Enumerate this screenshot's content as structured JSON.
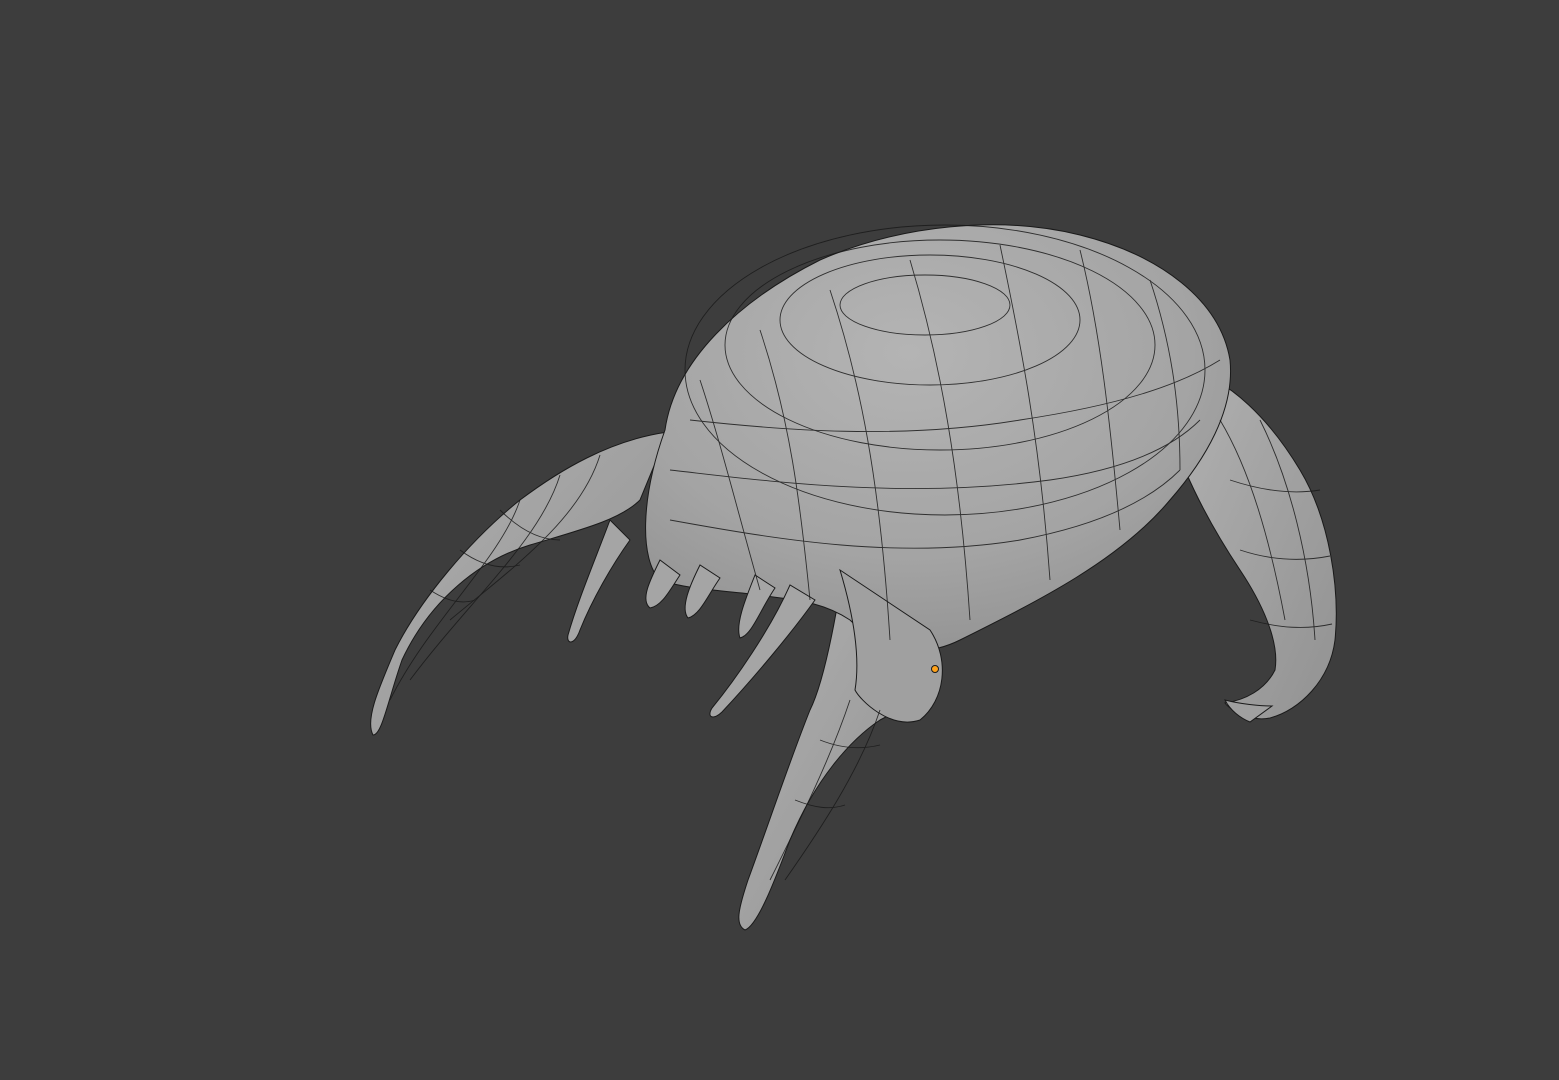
{
  "viewport": {
    "background_color": "#3d3d3d",
    "mesh_color": "#a6a6a6",
    "mesh_shadow_color": "#8c8c8c",
    "wire_color": "#1a1a1a",
    "origin_color": "#ffa21a"
  }
}
